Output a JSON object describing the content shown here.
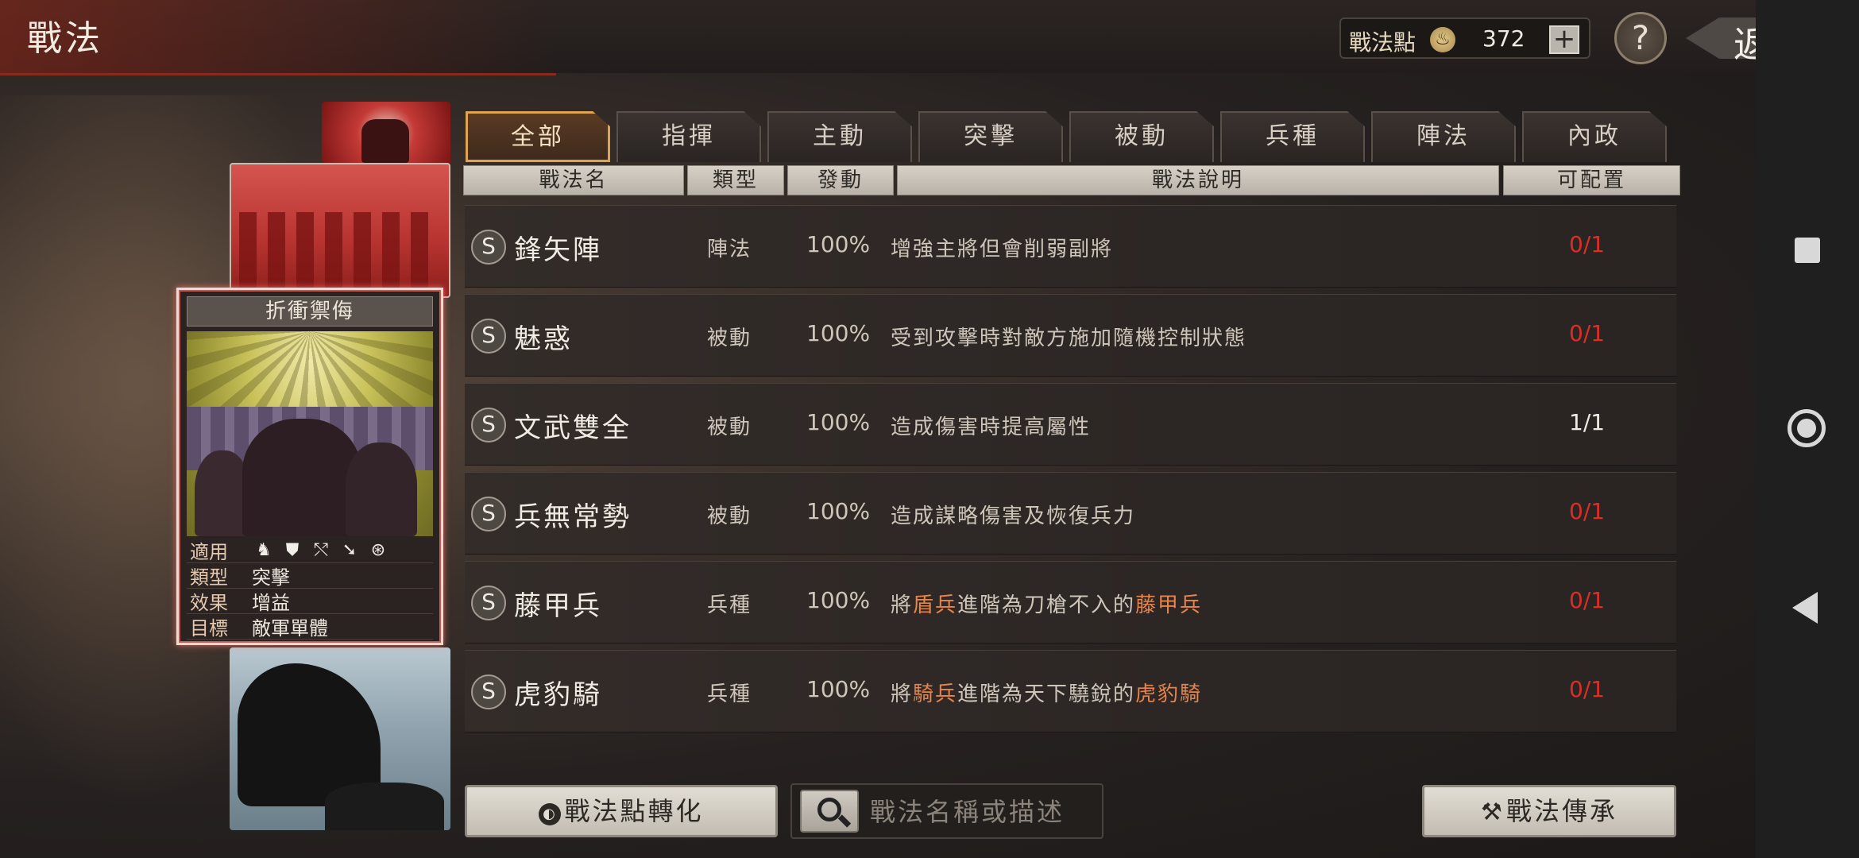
{
  "header": {
    "title": "戰法",
    "points_label": "戰法點",
    "points_icon": "drop-icon",
    "points_value": "372",
    "add_label": "+",
    "help_label": "?",
    "back_label": "返回"
  },
  "tabs": [
    {
      "label": "全部",
      "active": true
    },
    {
      "label": "指揮"
    },
    {
      "label": "主動"
    },
    {
      "label": "突擊"
    },
    {
      "label": "被動"
    },
    {
      "label": "兵種"
    },
    {
      "label": "陣法"
    },
    {
      "label": "內政"
    }
  ],
  "columns": [
    "戰法名",
    "類型",
    "發動",
    "戰法說明",
    "可配置"
  ],
  "rows": [
    {
      "grade": "S",
      "name": "鋒矢陣",
      "type": "陣法",
      "rate": "100%",
      "desc": [
        "增強主將但會削弱副將"
      ],
      "config": "0/1"
    },
    {
      "grade": "S",
      "name": "魅惑",
      "type": "被動",
      "rate": "100%",
      "desc": [
        "受到攻擊時對敵方施加隨機控制狀態"
      ],
      "config": "0/1"
    },
    {
      "grade": "S",
      "name": "文武雙全",
      "type": "被動",
      "rate": "100%",
      "desc": [
        "造成傷害時提高屬性"
      ],
      "config": "1/1"
    },
    {
      "grade": "S",
      "name": "兵無常勢",
      "type": "被動",
      "rate": "100%",
      "desc": [
        "造成謀略傷害及恢復兵力"
      ],
      "config": "0/1"
    },
    {
      "grade": "S",
      "name": "藤甲兵",
      "type": "兵種",
      "rate": "100%",
      "desc": [
        "將",
        "盾兵",
        "進階為刀槍不入的",
        "藤甲兵"
      ],
      "config": "0/1"
    },
    {
      "grade": "S",
      "name": "虎豹騎",
      "type": "兵種",
      "rate": "100%",
      "desc": [
        "將",
        "騎兵",
        "進階為天下驍銳的",
        "虎豹騎"
      ],
      "config": "0/1"
    }
  ],
  "card": {
    "name": "折衝禦侮",
    "info": [
      {
        "key": "適用",
        "value": ""
      },
      {
        "key": "類型",
        "value": "突擊"
      },
      {
        "key": "效果",
        "value": "增益"
      },
      {
        "key": "目標",
        "value": "敵軍單體"
      }
    ],
    "unit_icons": [
      "cavalry-icon",
      "shield-icon",
      "bow-icon",
      "spear-icon",
      "wheel-icon"
    ]
  },
  "bottom": {
    "convert_label": "戰法點轉化",
    "search_placeholder": "戰法名稱或描述",
    "inherit_label": "戰法傳承"
  },
  "colors": {
    "highlight": "#e8844a",
    "config_unavailable": "#d92f27",
    "tab_active_border": "#e0a450"
  }
}
